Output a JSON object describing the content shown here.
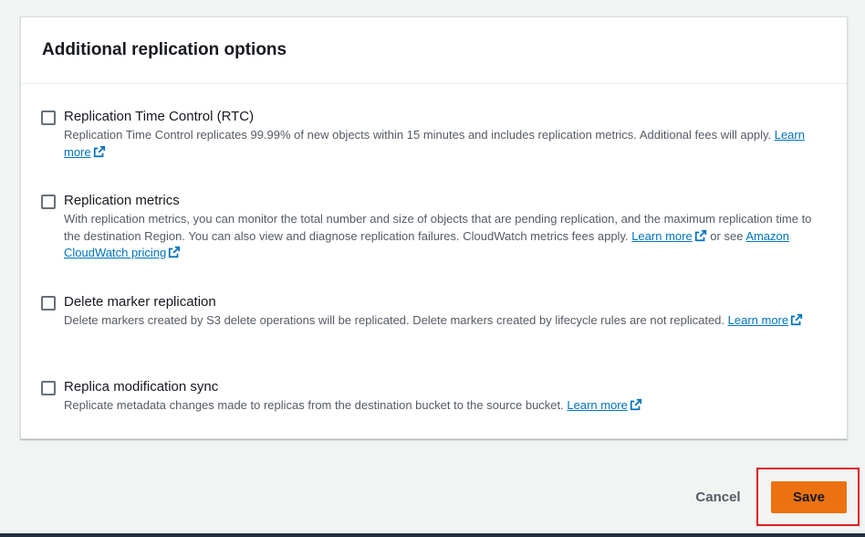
{
  "panel": {
    "title": "Additional replication options"
  },
  "options": [
    {
      "label": "Replication Time Control (RTC)",
      "checked": false,
      "desc_before": "Replication Time Control replicates 99.99% of new objects within 15 minutes and includes replication metrics. Additional fees will apply. ",
      "link1": "Learn more",
      "desc_middle": "",
      "link2": ""
    },
    {
      "label": "Replication metrics",
      "checked": false,
      "desc_before": "With replication metrics, you can monitor the total number and size of objects that are pending replication, and the maximum replication time to the destination Region. You can also view and diagnose replication failures. CloudWatch metrics fees apply. ",
      "link1": "Learn more",
      "desc_middle": " or see ",
      "link2": "Amazon CloudWatch pricing"
    },
    {
      "label": "Delete marker replication",
      "checked": false,
      "desc_before": "Delete markers created by S3 delete operations will be replicated. Delete markers created by lifecycle rules are not replicated. ",
      "link1": "Learn more",
      "desc_middle": "",
      "link2": ""
    },
    {
      "label": "Replica modification sync",
      "checked": false,
      "desc_before": "Replicate metadata changes made to replicas from the destination bucket to the source bucket. ",
      "link1": "Learn more",
      "desc_middle": "",
      "link2": ""
    }
  ],
  "actions": {
    "cancel_label": "Cancel",
    "save_label": "Save"
  },
  "colors": {
    "link": "#0073bb",
    "primary_button": "#ec7211",
    "highlight_border": "#e02020"
  },
  "icons": {
    "external_link": "external-link-icon"
  }
}
